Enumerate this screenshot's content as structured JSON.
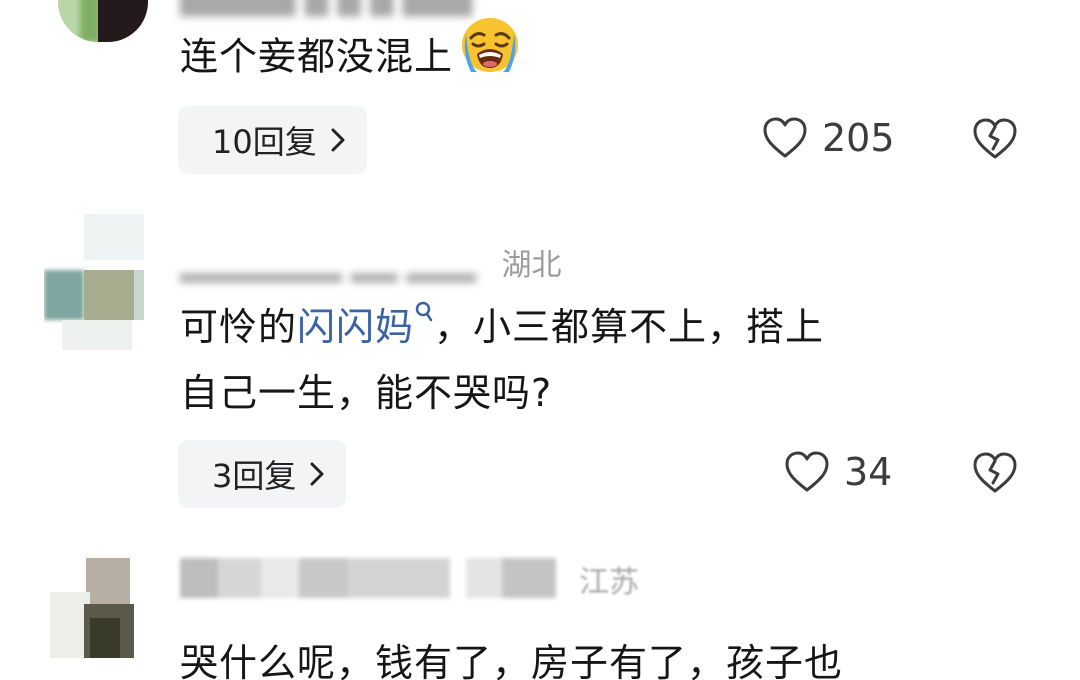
{
  "comments": [
    {
      "meta_location": "",
      "text_lines": [
        "连个妾都没混上"
      ],
      "reply_label": "10回复",
      "likes": "205"
    },
    {
      "meta_location": "湖北",
      "text_before_link": "可怜的",
      "link_text": "闪闪妈",
      "text_after_link": "，小三都算不上，搭上",
      "text_line2": "自己一生，能不哭吗?",
      "reply_label": "3回复",
      "likes": "34"
    },
    {
      "meta_location": "江苏",
      "text_lines": [
        "哭什么呢，钱有了，房子有了，孩子也"
      ]
    }
  ],
  "icons": {
    "crying_emoji": "loudly-crying-face-icon",
    "like": "heart-outline-icon",
    "dislike": "broken-heart-icon",
    "chevron": "chevron-right-icon",
    "search": "search-icon"
  },
  "colors": {
    "link": "#3a62a8",
    "reply_bg": "#f3f4f6",
    "text": "#161616",
    "meta": "#9c9c9c"
  }
}
